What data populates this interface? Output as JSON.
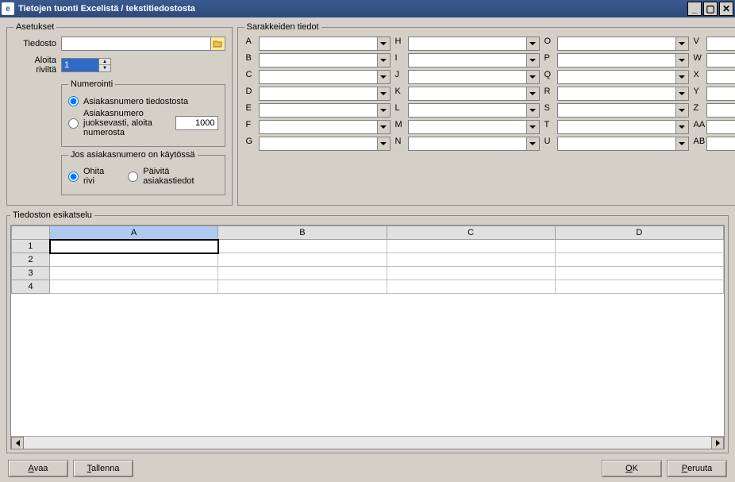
{
  "titlebar": {
    "icon_letter": "e",
    "title": "Tietojen tuonti Excelistä / tekstitiedostosta"
  },
  "settings": {
    "legend": "Asetukset",
    "file_label": "Tiedosto",
    "file_value": "",
    "start_row_label": "Aloita riviltä",
    "start_row_value": "1",
    "numbering": {
      "legend": "Numerointi",
      "from_file_label": "Asiakasnumero tiedostosta",
      "running_label": "Asiakasnumero juoksevasti, aloita numerosta",
      "running_start": "1000"
    },
    "inuse": {
      "legend": "Jos asiakasnumero on käytössä",
      "skip_label": "Ohita rivi",
      "update_label": "Päivitä asiakastiedot"
    }
  },
  "columns": {
    "legend": "Sarakkeiden tiedot",
    "labels": [
      "A",
      "B",
      "C",
      "D",
      "E",
      "F",
      "G",
      "H",
      "I",
      "J",
      "K",
      "L",
      "M",
      "N",
      "O",
      "P",
      "Q",
      "R",
      "S",
      "T",
      "U",
      "V",
      "W",
      "X",
      "Y",
      "Z",
      "AA",
      "AB"
    ]
  },
  "preview": {
    "legend": "Tiedoston esikatselu",
    "col_headers": [
      "A",
      "B",
      "C",
      "D"
    ],
    "row_headers": [
      "1",
      "2",
      "3",
      "4"
    ]
  },
  "buttons": {
    "open": "Avaa",
    "save": "Tallenna",
    "ok": "OK",
    "cancel": "Peruuta"
  }
}
